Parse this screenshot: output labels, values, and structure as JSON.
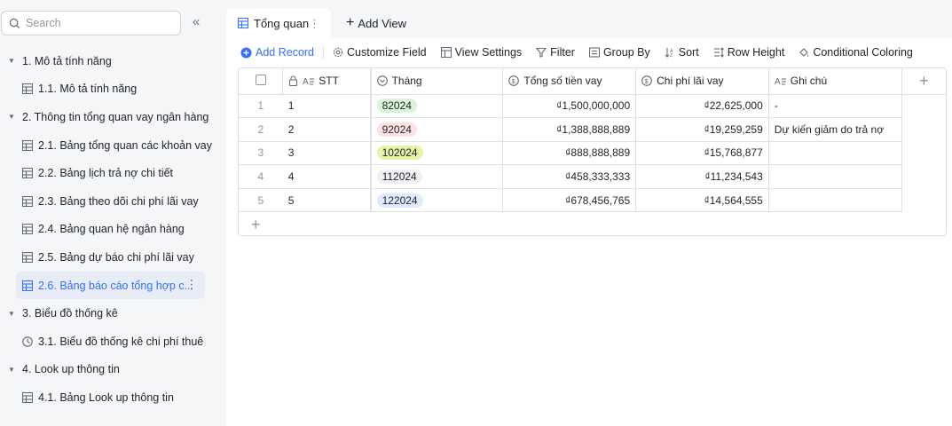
{
  "sidebar": {
    "search_placeholder": "Search",
    "collapse_icon": "double-chevron-left-icon",
    "items": [
      {
        "label": "1. Mô tả tính năng",
        "level": 0
      },
      {
        "label": "1.1. Mô tả tính năng",
        "level": 1,
        "icon": "table-icon"
      },
      {
        "label": "2. Thông tin tổng quan vay ngân hàng",
        "level": 0
      },
      {
        "label": "2.1. Bảng tổng quan các khoản vay",
        "level": 1,
        "icon": "table-icon"
      },
      {
        "label": "2.2. Bảng lịch trả nợ chi tiết",
        "level": 1,
        "icon": "table-icon"
      },
      {
        "label": "2.3. Bảng theo dõi chi phí lãi vay",
        "level": 1,
        "icon": "table-icon"
      },
      {
        "label": "2.4. Bảng quan hệ ngân hàng",
        "level": 1,
        "icon": "table-icon"
      },
      {
        "label": "2.5. Bảng dự báo chi phí lãi vay",
        "level": 1,
        "icon": "table-icon"
      },
      {
        "label": "2.6. Bảng báo cáo tổng hợp c...",
        "level": 1,
        "icon": "table-icon",
        "active": true
      },
      {
        "label": "3. Biểu đồ thống kê",
        "level": 0
      },
      {
        "label": "3.1. Biểu đồ thống kê chi phí thuê",
        "level": 1,
        "icon": "dashboard-icon"
      },
      {
        "label": "4. Look up thông tin",
        "level": 0
      },
      {
        "label": "4.1. Bảng Look up thông tin",
        "level": 1,
        "icon": "table-icon"
      }
    ]
  },
  "tabs": {
    "active": "Tổng quan",
    "add_view": "Add View"
  },
  "toolbar": {
    "add_record": "Add Record",
    "customize_field": "Customize Field",
    "view_settings": "View Settings",
    "filter": "Filter",
    "group_by": "Group By",
    "sort": "Sort",
    "row_height": "Row Height",
    "conditional_coloring": "Conditional Coloring"
  },
  "grid": {
    "columns": {
      "stt": "STT",
      "thang": "Tháng",
      "tong_so_tien_vay": "Tổng số tiền vay",
      "chi_phi_lai_vay": "Chi phí lãi vay",
      "ghi_chu": "Ghi chú"
    },
    "rows": [
      {
        "idx": "1",
        "stt": "1",
        "thang": "82024",
        "tag_color": "#d9f5d6",
        "tong": "₫1,500,000,000",
        "chi_phi": "₫22,625,000",
        "ghi_chu": "-"
      },
      {
        "idx": "2",
        "stt": "2",
        "thang": "92024",
        "tag_color": "#fde2e2",
        "tong": "₫1,388,888,889",
        "chi_phi": "₫19,259,259",
        "ghi_chu": "Dự kiến giảm do trả nợ"
      },
      {
        "idx": "3",
        "stt": "3",
        "thang": "102024",
        "tag_color": "#e4f5a8",
        "tong": "₫888,888,889",
        "chi_phi": "₫15,768,877",
        "ghi_chu": ""
      },
      {
        "idx": "4",
        "stt": "4",
        "thang": "112024",
        "tag_color": "#eff0f1",
        "tong": "₫458,333,333",
        "chi_phi": "₫11,234,543",
        "ghi_chu": ""
      },
      {
        "idx": "5",
        "stt": "5",
        "thang": "122024",
        "tag_color": "#e1eaff",
        "tong": "₫678,456,765",
        "chi_phi": "₫14,564,555",
        "ghi_chu": ""
      }
    ]
  },
  "colors": {
    "accent": "#3370ff",
    "active_bg": "#e7ecf7"
  }
}
